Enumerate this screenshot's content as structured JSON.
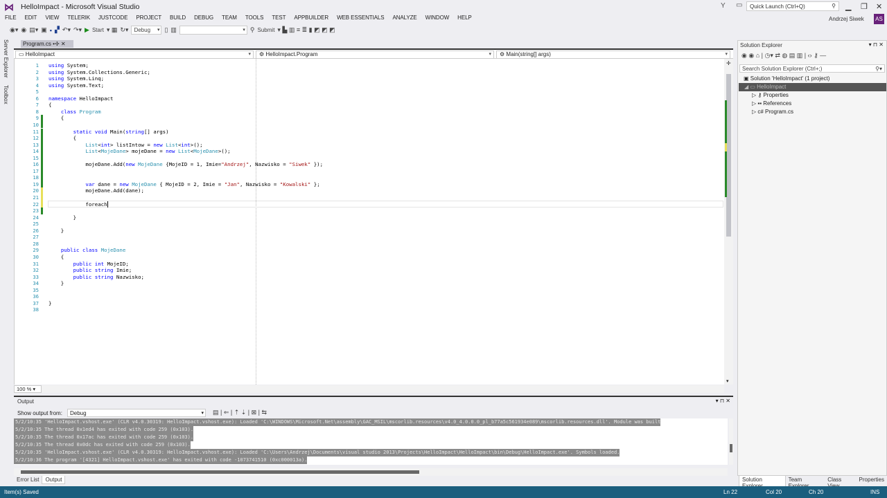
{
  "window": {
    "title": "HelloImpact - Microsoft Visual Studio",
    "quick_launch_placeholder": "Quick Launch (Ctrl+Q)",
    "user": "Andrzej Siwek",
    "avatar_initials": "AS",
    "accent": "#68217a"
  },
  "menu": [
    "FILE",
    "EDIT",
    "VIEW",
    "TELERIK",
    "JUSTCODE",
    "PROJECT",
    "BUILD",
    "DEBUG",
    "TEAM",
    "TOOLS",
    "TEST",
    "APPBUILDER",
    "WEB ESSENTIALS",
    "ANALYZE",
    "WINDOW",
    "HELP"
  ],
  "toolbar": {
    "start": "Start",
    "config": "Debug",
    "submit": "Submit"
  },
  "left_tabs": [
    "Server Explorer",
    "Toolbox"
  ],
  "document_tab": "Program.cs",
  "navbar": {
    "project": "HelloImpact",
    "class": "HelloImpact.Program",
    "member": "Main(string[] args)"
  },
  "editor": {
    "current_line": 22,
    "zoom": "100 %",
    "lines": [
      "using System;",
      "using System.Collections.Generic;",
      "using System.Linq;",
      "using System.Text;",
      "",
      "namespace HelloImpact",
      "{",
      "    class Program",
      "    {",
      "",
      "        static void Main(string[] args)",
      "        {",
      "            List<int> listIntow = new List<int>();",
      "            List<MojeDane> mojeDane = new List<MojeDane>();",
      "",
      "            mojeDane.Add(new MojeDane {MojeID = 1, Imie=\"Andrzej\", Nazwisko = \"Siwek\" });",
      "",
      "",
      "            var dane = new MojeDane { MojeID = 2, Imie = \"Jan\", Nazwisko = \"Kowalski\" };",
      "            mojeDane.Add(dane);",
      "",
      "            foreach",
      "",
      "        }",
      "",
      "    }",
      "",
      "",
      "    public class MojeDane",
      "    {",
      "        public int MojeID;",
      "        public string Imie;",
      "        public string Nazwisko;",
      "    }",
      "",
      "",
      "}",
      ""
    ]
  },
  "output": {
    "title": "Output",
    "show_from_label": "Show output from:",
    "source": "Debug",
    "lines": [
      "5/2/10:35 'HelloImpact.vshost.exe' (CLR v4.0.30319: HelloImpact.vshost.exe): Loaded 'C:\\WINDOWS\\Microsoft.Net\\assembly\\GAC_MSIL\\mscorlib.resources\\v4.0_4.0.0.0_pl_b77a5c561934e089\\mscorlib.resources.dll'. Module was built",
      "5/2/10:35 The thread 0x1ed4 has exited with code 259 (0x103).",
      "5/2/10:35 The thread 0x17ac has exited with code 259 (0x103).",
      "5/2/10:35 The thread 0x0dc has exited with code 259 (0x103).",
      "5/2/10:35 'HelloImpact.vshost.exe' (CLR v4.0.30319: HelloImpact.vshost.exe): Loaded 'C:\\Users\\Andrzej\\Documents\\visual studio 2013\\Projects\\HelloImpact\\HelloImpact\\bin\\Debug\\HelloImpact.exe'. Symbols loaded.",
      "5/2/10:36 The program '[4321] HelloImpact.vshost.exe' has exited with code -1073741510 (0xc000013a)."
    ]
  },
  "bottom_tabs": [
    "Error List",
    "Output"
  ],
  "solution_explorer": {
    "title": "Solution Explorer",
    "search_placeholder": "Search Solution Explorer (Ctrl+;)",
    "solution": "Solution 'HelloImpact' (1 project)",
    "project": "HelloImpact",
    "items": [
      "Properties",
      "References",
      "Program.cs"
    ]
  },
  "right_tabs": [
    "Solution Explorer",
    "Team Explorer",
    "Class View",
    "Properties"
  ],
  "status": {
    "message": "Item(s) Saved",
    "ln": "Ln 22",
    "col": "Col 20",
    "ch": "Ch 20",
    "mode": "INS",
    "color": "#1b5e7e"
  }
}
